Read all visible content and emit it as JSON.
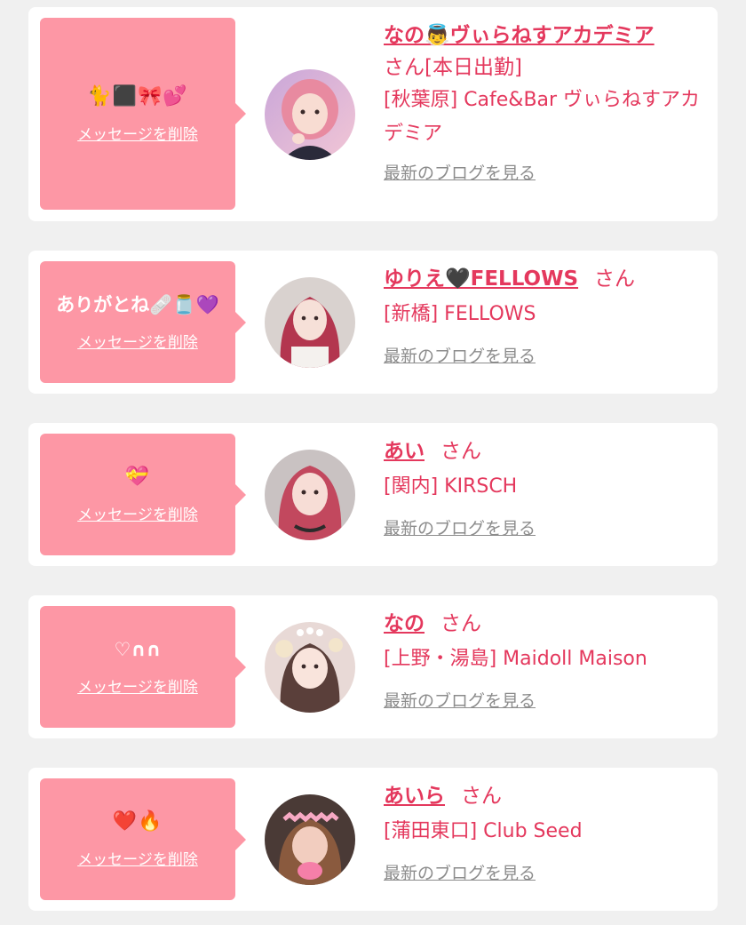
{
  "favorites": [
    {
      "message": "🐈⬛🎀💕",
      "delete_label": "メッセージを削除",
      "name": "なの👼ヴぃらねすアカデミア",
      "san": "さん[本日出勤]",
      "shop": "[秋葉原] Cafe&Bar ヴぃらねすアカデミア",
      "blog_label": "最新のブログを見る"
    },
    {
      "message": "ありがとね🩹🫙💜",
      "delete_label": "メッセージを削除",
      "name": "ゆりえ🖤FELLOWS",
      "san": "さん",
      "shop": "[新橋] FELLOWS",
      "blog_label": "最新のブログを見る"
    },
    {
      "message": "💝",
      "delete_label": "メッセージを削除",
      "name": "あい",
      "san": "さん",
      "shop": "[関内] KIRSCH",
      "blog_label": "最新のブログを見る"
    },
    {
      "message": "♡∩∩",
      "delete_label": "メッセージを削除",
      "name": "なの",
      "san": "さん",
      "shop": "[上野・湯島] Maidoll Maison",
      "blog_label": "最新のブログを見る"
    },
    {
      "message": "❤️🔥",
      "delete_label": "メッセージを削除",
      "name": "あいら",
      "san": "さん",
      "shop": "[蒲田東口] Club Seed",
      "blog_label": "最新のブログを見る"
    }
  ],
  "colors": {
    "page_background": "#f0f0f0",
    "card_background": "#ffffff",
    "bubble": "#fd97a5",
    "accent_text": "#e4385d",
    "link_gray": "#8c8c8c"
  }
}
